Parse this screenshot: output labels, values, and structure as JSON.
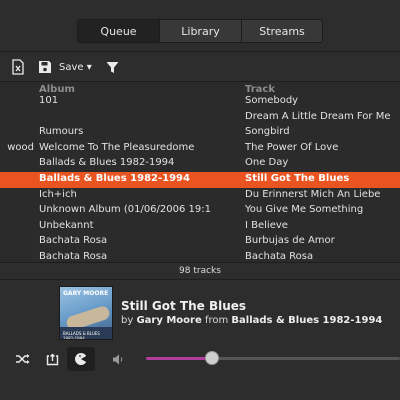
{
  "tabs": [
    {
      "label": "Queue",
      "active": true
    },
    {
      "label": "Library",
      "active": false
    },
    {
      "label": "Streams",
      "active": false
    }
  ],
  "toolbar": {
    "save_label": "Save ▾"
  },
  "columns": {
    "album": "Album",
    "track": "Track"
  },
  "rows": [
    {
      "artist": "",
      "album": "101",
      "track": "Somebody"
    },
    {
      "artist": "",
      "album": "",
      "track": "Dream A Little Dream For Me"
    },
    {
      "artist": "",
      "album": "Rumours",
      "track": "Songbird"
    },
    {
      "artist": "wood",
      "album": "Welcome To The Pleasuredome",
      "track": "The Power Of Love"
    },
    {
      "artist": "",
      "album": "Ballads & Blues 1982-1994",
      "track": "One Day"
    },
    {
      "artist": "",
      "album": "Ballads & Blues 1982-1994",
      "track": "Still Got The Blues",
      "selected": true
    },
    {
      "artist": "",
      "album": "Ich+ich",
      "track": "Du Erinnerst Mich An Liebe"
    },
    {
      "artist": "",
      "album": "Unknown Album (01/06/2006 19:1",
      "track": "You Give Me Something"
    },
    {
      "artist": "",
      "album": "Unbekannt",
      "track": "I Believe"
    },
    {
      "artist": "",
      "album": "Bachata Rosa",
      "track": "Burbujas de Amor"
    },
    {
      "artist": "",
      "album": "Bachata Rosa",
      "track": "Bachata Rosa"
    }
  ],
  "track_count": "98 tracks",
  "now_playing": {
    "title": "Still Got The Blues",
    "by_word": "by",
    "artist": "Gary Moore",
    "from_word": "from",
    "album": "Ballads & Blues 1982-1994",
    "cover_artist": "GARY MOORE",
    "cover_title": "BALLADS & BLUES 1982-1994"
  },
  "volume_level": 0.26,
  "colors": {
    "selection": "#e95420",
    "slider_fill": "#b03c9b"
  },
  "icons": [
    "clear-queue-icon",
    "save-icon",
    "filter-icon",
    "shuffle-icon",
    "repeat-icon",
    "consume-icon",
    "volume-icon"
  ]
}
